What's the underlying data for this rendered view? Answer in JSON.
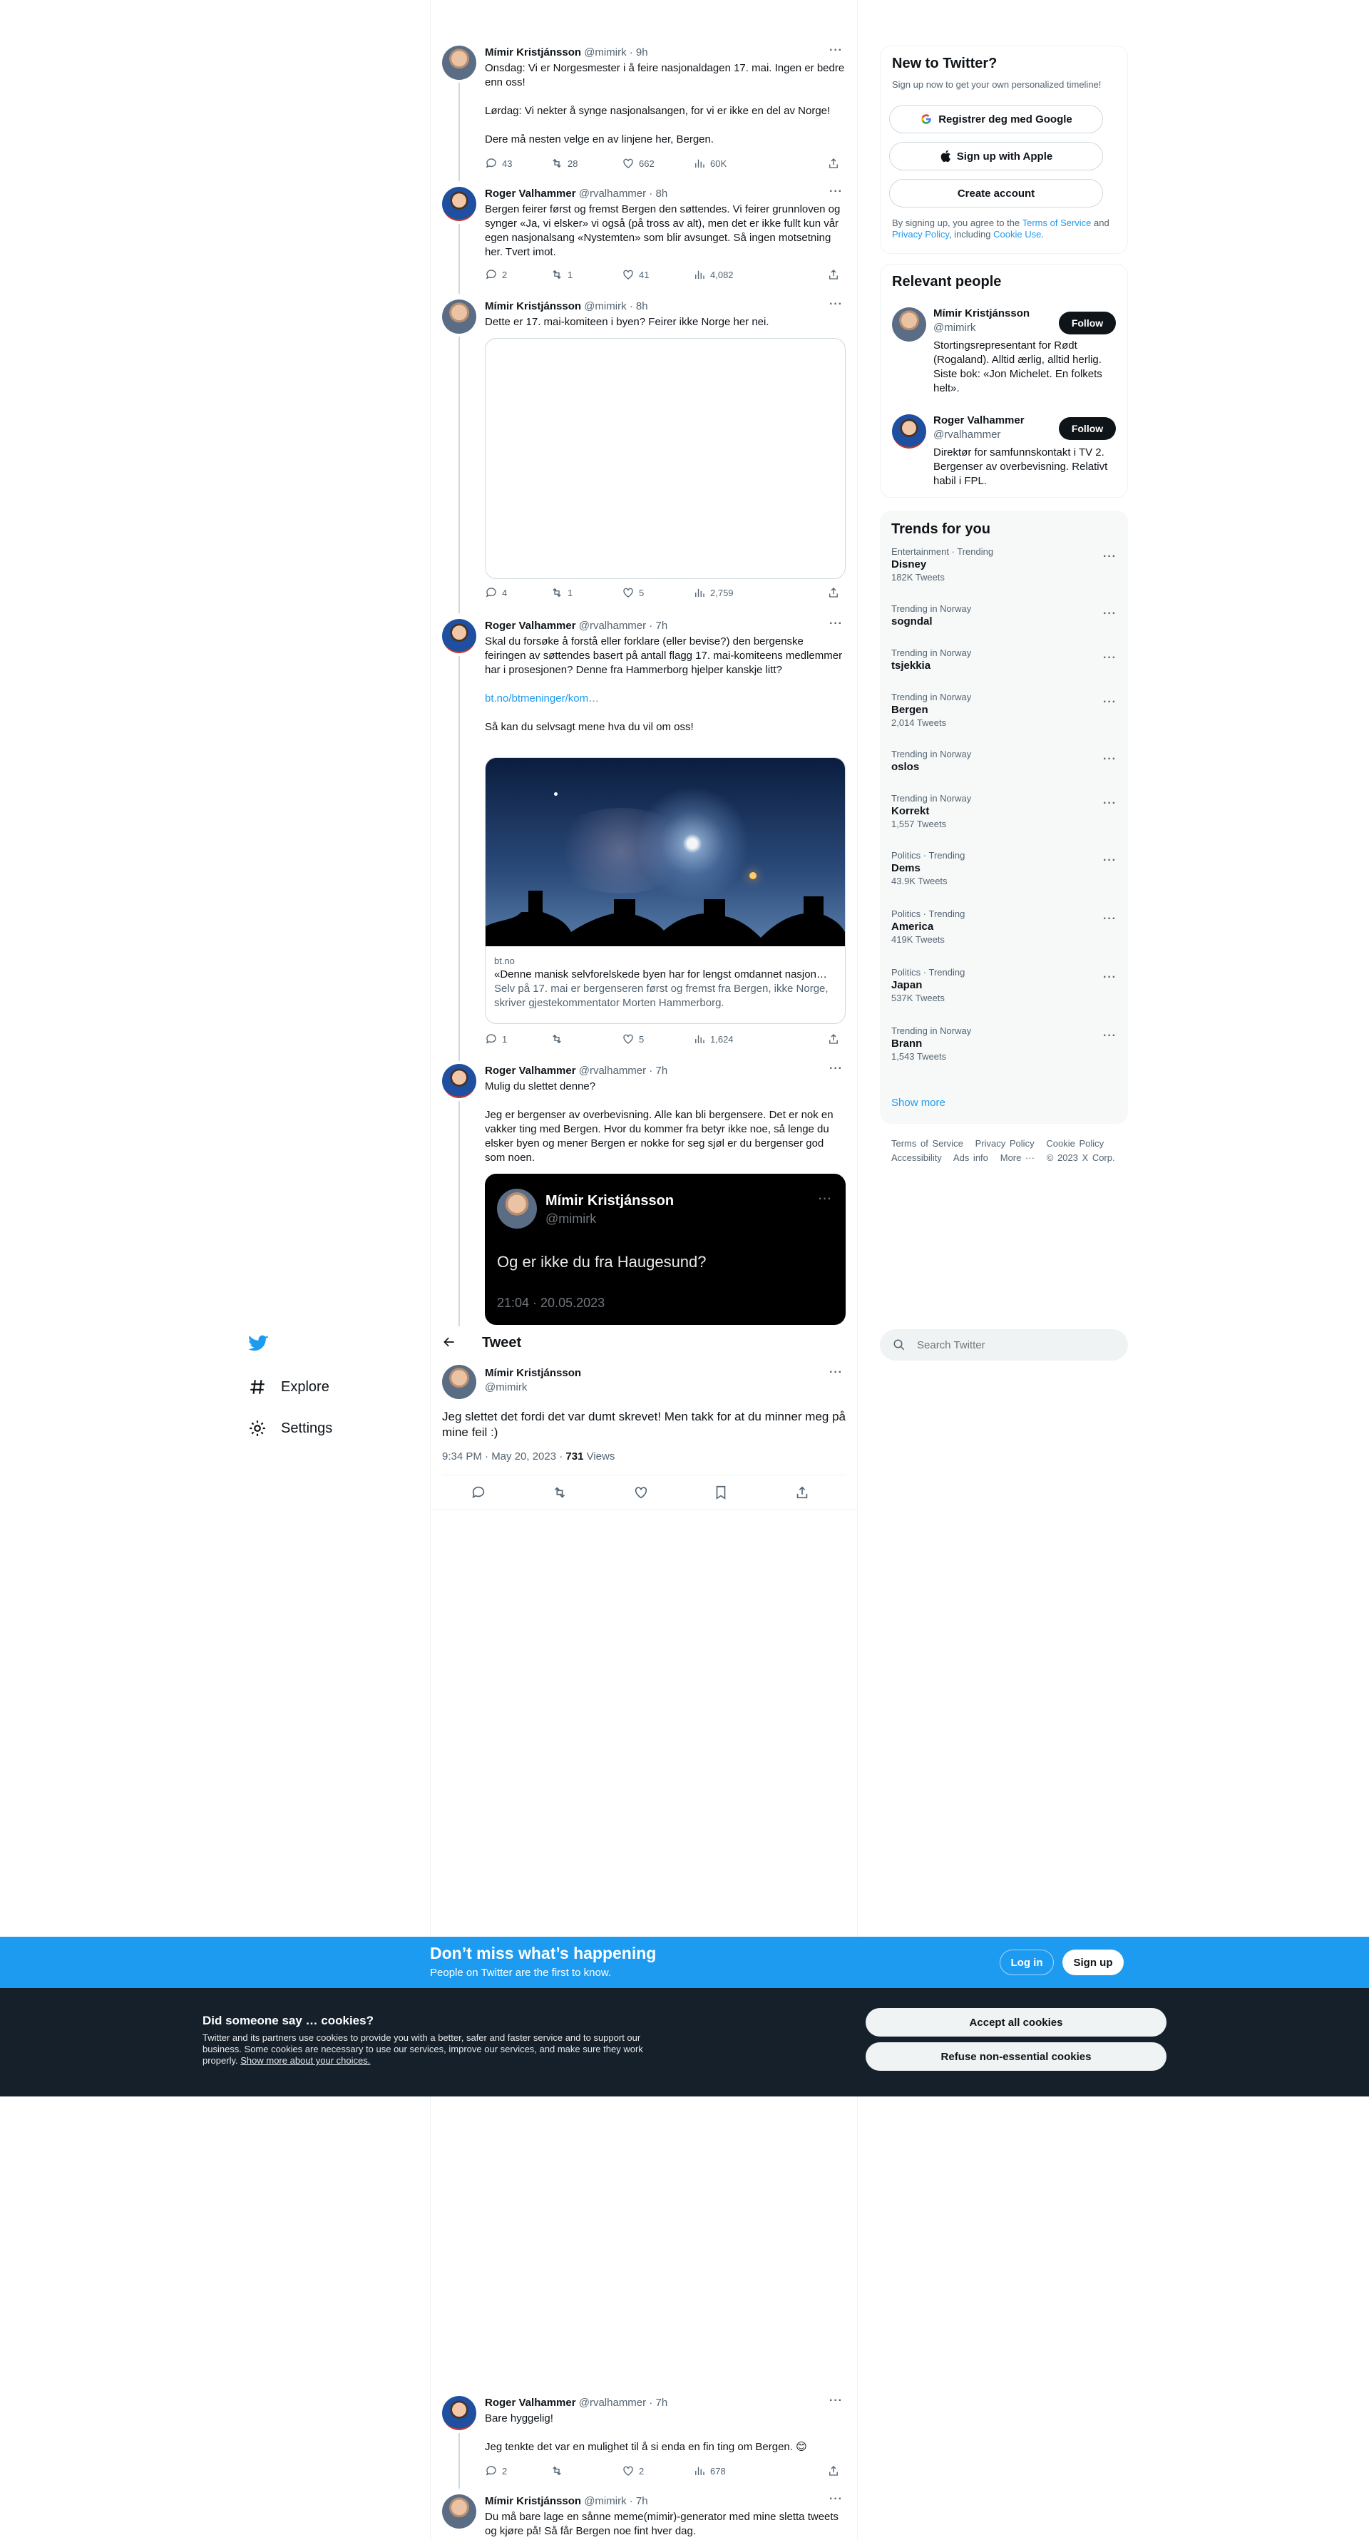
{
  "colors": {
    "accent": "#1d9bf0",
    "text": "#0f1419",
    "muted": "#536471",
    "dark": "#15202b"
  },
  "nav": {
    "explore": "Explore",
    "settings": "Settings",
    "logo_icon": "twitter-bird-icon"
  },
  "search": {
    "placeholder": "Search Twitter"
  },
  "header": {
    "title": "Tweet"
  },
  "tweets": [
    {
      "name": "Mímir Kristjánsson",
      "handle": "@mimirk · 9h",
      "lines": [
        "Onsdag: Vi er Norgesmester i å feire nasjonaldagen 17. mai. Ingen er bedre enn oss!",
        "Lørdag: Vi nekter å synge nasjonalsangen, for vi er ikke en del av Norge!",
        "Dere må nesten velge en av linjene her, Bergen."
      ],
      "replies": "43",
      "retweets": "28",
      "likes": "662",
      "views": "60K"
    },
    {
      "name": "Roger Valhammer",
      "handle": "@rvalhammer · 8h",
      "lines": [
        "Bergen feirer først og fremst Bergen den søttendes. Vi feirer grunnloven og synger «Ja, vi elsker» vi også (på tross av alt), men det er ikke fullt kun vår egen nasjonalsang «Nystemten» som blir avsunget. Så ingen motsetning her. Tvert imot."
      ],
      "replies": "2",
      "retweets": "1",
      "likes": "41",
      "views": "4,082"
    },
    {
      "name": "Mímir Kristjánsson",
      "handle": "@mimirk · 8h",
      "lines": [
        "Dette er 17. mai-komiteen i byen? Feirer ikke Norge her nei."
      ],
      "replies": "4",
      "retweets": "1",
      "likes": "5",
      "views": "2,759"
    },
    {
      "name": "Roger Valhammer",
      "handle": "@rvalhammer · 7h",
      "lines": [
        "Skal du forsøke å forstå eller forklare (eller bevise?) den bergenske feiringen av søttendes basert på antall flagg 17. mai-komiteens medlemmer har i prosesjonen? Denne fra Hammerborg hjelper kanskje litt?"
      ],
      "link": "bt.no/btmeninger/kom…",
      "after": "Så kan du selvsagt mene hva du vil om oss!",
      "card_domain": "bt.no",
      "card_title": "«Denne manisk selvforelskede byen har for lengst omdannet nasjon…",
      "card_desc": "Selv på 17. mai er bergenseren først og fremst fra Bergen, ikke Norge, skriver gjestekommentator Morten Hammerborg.",
      "replies": "1",
      "retweets": "",
      "likes": "5",
      "views": "1,624"
    },
    {
      "name": "Roger Valhammer",
      "handle": "@rvalhammer · 7h",
      "lines": [
        "Mulig du slettet denne?",
        "Jeg er bergenser av overbevisning. Alle kan bli bergensere. Det er nok en vakker ting med Bergen. Hvor du kommer fra betyr ikke noe, så lenge du elsker byen og mener Bergen er nokke for seg sjøl er du bergenser god som noen."
      ],
      "quote_name": "Mímir Kristjánsson",
      "quote_handle": "@mimirk",
      "quote_text": "Og er ikke du fra Haugesund?",
      "quote_time": "21:04 · 20.05.2023"
    }
  ],
  "main_tweet": {
    "name": "Mímir Kristjánsson",
    "handle": "@mimirk",
    "text": "Jeg slettet det fordi det var dumt skrevet! Men takk for at du minner meg på mine feil :)",
    "time": "9:34 PM · May 20, 2023 · ",
    "views_count": "731",
    "views_label": " Views"
  },
  "bottom_tweets": [
    {
      "name": "Roger Valhammer",
      "handle": "@rvalhammer · 7h",
      "lines": [
        "Bare hyggelig!",
        "Jeg tenkte det var en mulighet til å si enda en fin ting om Bergen. 😊"
      ],
      "replies": "2",
      "retweets": "",
      "likes": "2",
      "views": "678"
    },
    {
      "name": "Mímir Kristjánsson",
      "handle": "@mimirk · 7h",
      "lines": [
        "Du må bare lage en sånne meme(mimir)-generator med mine sletta tweets og kjøre på! Så får Bergen noe fint hver dag."
      ]
    }
  ],
  "new_to_twitter": {
    "title": "New to Twitter?",
    "sub": "Sign up now to get your own personalized timeline!",
    "google": "Registrer deg med Google",
    "apple": "Sign up with Apple",
    "create": "Create account",
    "legal_1": "By signing up, you agree to the ",
    "tos": "Terms of Service",
    "legal_2": " and ",
    "privacy": "Privacy Policy",
    "legal_3": ", including ",
    "cookie": "Cookie Use",
    "legal_4": "."
  },
  "relevant": {
    "title": "Relevant people",
    "follow": "Follow",
    "people": [
      {
        "name": "Mímir Kristjánsson",
        "handle": "@mimirk",
        "bio": "Stortingsrepresentant for Rødt (Rogaland). Alltid ærlig, alltid herlig. Siste bok: «Jon Michelet. En folkets helt»."
      },
      {
        "name": "Roger Valhammer",
        "handle": "@rvalhammer",
        "bio": "Direktør for samfunnskontakt i TV 2. Bergenser av overbevisning. Relativt habil i FPL."
      }
    ]
  },
  "trends": {
    "title": "Trends for you",
    "show_more": "Show more",
    "items": [
      {
        "cat": "Entertainment · Trending",
        "name": "Disney",
        "count": "182K Tweets"
      },
      {
        "cat": "Trending in Norway",
        "name": "sogndal",
        "count": ""
      },
      {
        "cat": "Trending in Norway",
        "name": "tsjekkia",
        "count": ""
      },
      {
        "cat": "Trending in Norway",
        "name": "Bergen",
        "count": "2,014 Tweets"
      },
      {
        "cat": "Trending in Norway",
        "name": "oslos",
        "count": ""
      },
      {
        "cat": "Trending in Norway",
        "name": "Korrekt",
        "count": "1,557 Tweets"
      },
      {
        "cat": "Politics · Trending",
        "name": "Dems",
        "count": "43.9K Tweets"
      },
      {
        "cat": "Politics · Trending",
        "name": "America",
        "count": "419K Tweets"
      },
      {
        "cat": "Politics · Trending",
        "name": "Japan",
        "count": "537K Tweets"
      },
      {
        "cat": "Trending in Norway",
        "name": "Brann",
        "count": "1,543 Tweets"
      }
    ]
  },
  "footer": {
    "l1": [
      "Terms of Service",
      "Privacy Policy",
      "Cookie Policy"
    ],
    "l2": [
      "Accessibility",
      "Ads info",
      "More ···",
      "© 2023 X Corp."
    ]
  },
  "banner": {
    "title": "Don’t miss what’s happening",
    "sub": "People on Twitter are the first to know.",
    "login": "Log in",
    "signup": "Sign up"
  },
  "cookies": {
    "title": "Did someone say … cookies?",
    "body": "Twitter and its partners use cookies to provide you with a better, safer and faster service and to support our business. Some cookies are necessary to use our services, improve our services, and make sure they work properly. ",
    "link": "Show more about your choices.",
    "accept": "Accept all cookies",
    "refuse": "Refuse non-essential cookies"
  }
}
